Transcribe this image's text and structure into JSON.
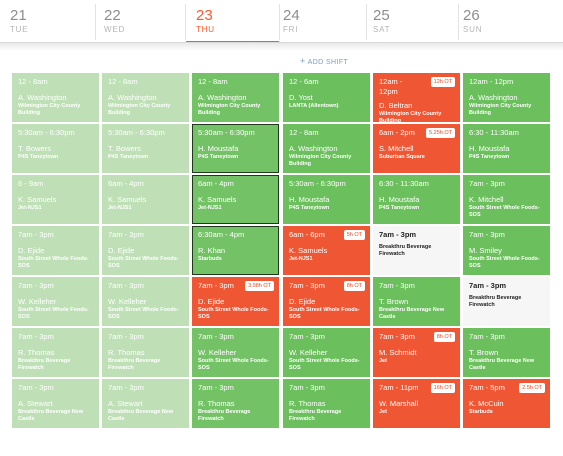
{
  "header": {
    "days": [
      {
        "num": "21",
        "dow": "TUE"
      },
      {
        "num": "22",
        "dow": "WED"
      },
      {
        "num": "23",
        "dow": "THU"
      },
      {
        "num": "24",
        "dow": "FRI"
      },
      {
        "num": "25",
        "dow": "SAT"
      },
      {
        "num": "26",
        "dow": "SUN"
      }
    ],
    "add_shift": "ADD SHIFT",
    "today_color": "#ff5a2d"
  },
  "columns": [
    {
      "shifts": [
        {
          "time": "12 - 8am",
          "name": "A. Washington",
          "loc": "Wilmington City County Building"
        },
        {
          "time": "5:30am - 6:30pm",
          "name": "T. Bowers",
          "loc": "P4S Taneytown"
        },
        {
          "time": "6 - 9am",
          "name": "K. Samuels",
          "loc": "Jet-NJS1"
        },
        {
          "time": "7am - 3pm",
          "name": "D. Ejide",
          "loc": "South Street Whole Foods-SOS"
        },
        {
          "time": "7am - 3pm",
          "name": "W. Kelleher",
          "loc": "South Street Whole Foods-SOS"
        },
        {
          "time": "7am - 3pm",
          "name": "R. Thomas",
          "loc": "Breakthru Beverage Firewatch"
        },
        {
          "time": "7am - 3pm",
          "name": "A. Stewart",
          "loc": "Breakthru Beverage New Castle"
        }
      ]
    },
    {
      "shifts": [
        {
          "time": "12 - 8am",
          "name": "A. Washington",
          "loc": "Wilmington City County Building"
        },
        {
          "time": "5:30am - 6:30pm",
          "name": "T. Bowers",
          "loc": "P4S Taneytown"
        },
        {
          "time": "6am - 4pm",
          "name": "K. Samuels",
          "loc": "Jet-NJS1"
        },
        {
          "time": "7am - 3pm",
          "name": "D. Ejide",
          "loc": "South Street Whole Foods-SOS"
        },
        {
          "time": "7am - 3pm",
          "name": "W. Kelleher",
          "loc": "South Street Whole Foods-SOS"
        },
        {
          "time": "7am - 3pm",
          "name": "R. Thomas",
          "loc": "Breakthru Beverage Firewatch"
        },
        {
          "time": "7am - 3pm",
          "name": "A. Stewart",
          "loc": "Breakthru Beverage New Castle"
        }
      ]
    },
    {
      "shifts": [
        {
          "time": "12 - 8am",
          "name": "A. Washington",
          "loc": "Wilmington City County Building"
        },
        {
          "time": "5:30am - 6:30pm",
          "name": "H. Moustafa",
          "loc": "P4S Taneytown"
        },
        {
          "time": "6am - 4pm",
          "name": "K. Samuels",
          "loc": "Jet-NJS1"
        },
        {
          "time": "6:30am - 4pm",
          "name": "R. Khan",
          "loc": "Starbuds"
        },
        {
          "time": "7am - 3pm",
          "name": "D. Ejide",
          "loc": "South Street Whole Foods-SOS",
          "badge": "3.98h OT"
        },
        {
          "time": "7am - 3pm",
          "name": "W. Kelleher",
          "loc": "South Street Whole Foods-SOS"
        },
        {
          "time": "7am - 3pm",
          "name": "R. Thomas",
          "loc": "Breakthru Beverage Firewatch"
        }
      ]
    },
    {
      "shifts": [
        {
          "time": "12 - 6am",
          "name": "D. Yost",
          "loc": "LANTA (Allentown)"
        },
        {
          "time": "12 - 8am",
          "name": "A. Washington",
          "loc": "Wilmington City County Building"
        },
        {
          "time": "5:30am - 6:30pm",
          "name": "H. Moustafa",
          "loc": "P4S Taneytown"
        },
        {
          "time": "6am - 6pm",
          "name": "K. Samuels",
          "loc": "Jet-NJS1",
          "badge": "5h OT"
        },
        {
          "time": "7am - 3pm",
          "name": "D. Ejide",
          "loc": "South Street Whole Foods-SOS",
          "badge": "8h OT"
        },
        {
          "time": "7am - 3pm",
          "name": "W. Kelleher",
          "loc": "South Street Whole Foods-SOS"
        },
        {
          "time": "7am - 3pm",
          "name": "R. Thomas",
          "loc": "Breakthru Beverage Firewatch"
        }
      ]
    },
    {
      "shifts": [
        {
          "time": "12am - 12pm",
          "name": "D. Beltran",
          "loc": "Wilmington City County Building",
          "badge": "12h OT"
        },
        {
          "time": "6am - 2pm",
          "name": "S. Mitchell",
          "loc": "Suburban Square",
          "badge": "5.25h OT"
        },
        {
          "time": "6:30 - 11:30am",
          "name": "H. Moustafa",
          "loc": "P4S Taneytown"
        },
        {
          "time": "7am - 3pm",
          "name": "",
          "loc": "Breakthru Beverage Firewatch"
        },
        {
          "time": "7am - 3pm",
          "name": "T. Brown",
          "loc": "Breakthru Beverage New Castle"
        },
        {
          "time": "7am - 3pm",
          "name": "M. Schmidt",
          "loc": "Jet",
          "badge": "8h OT"
        },
        {
          "time": "7am - 11pm",
          "name": "W. Marshall",
          "loc": "Jet",
          "badge": "16h OT"
        }
      ]
    },
    {
      "shifts": [
        {
          "time": "12am - 12pm",
          "name": "A. Washington",
          "loc": "Wilmington City County Building"
        },
        {
          "time": "6:30 - 11:30am",
          "name": "H. Moustafa",
          "loc": "P4S Taneytown"
        },
        {
          "time": "7am - 3pm",
          "name": "K. Mitchell",
          "loc": "South Street Whole Foods-SOS"
        },
        {
          "time": "7am - 3pm",
          "name": "M. Smiley",
          "loc": "South Street Whole Foods-SOS"
        },
        {
          "time": "7am - 3pm",
          "name": "",
          "loc": "Breakthru Beverage Firewatch"
        },
        {
          "time": "7am - 3pm",
          "name": "T. Brown",
          "loc": "Breakthru Beverage New Castle"
        },
        {
          "time": "7am - 5pm",
          "name": "K. McCuin",
          "loc": "Starbuds",
          "badge": "2.5h OT"
        }
      ]
    }
  ]
}
